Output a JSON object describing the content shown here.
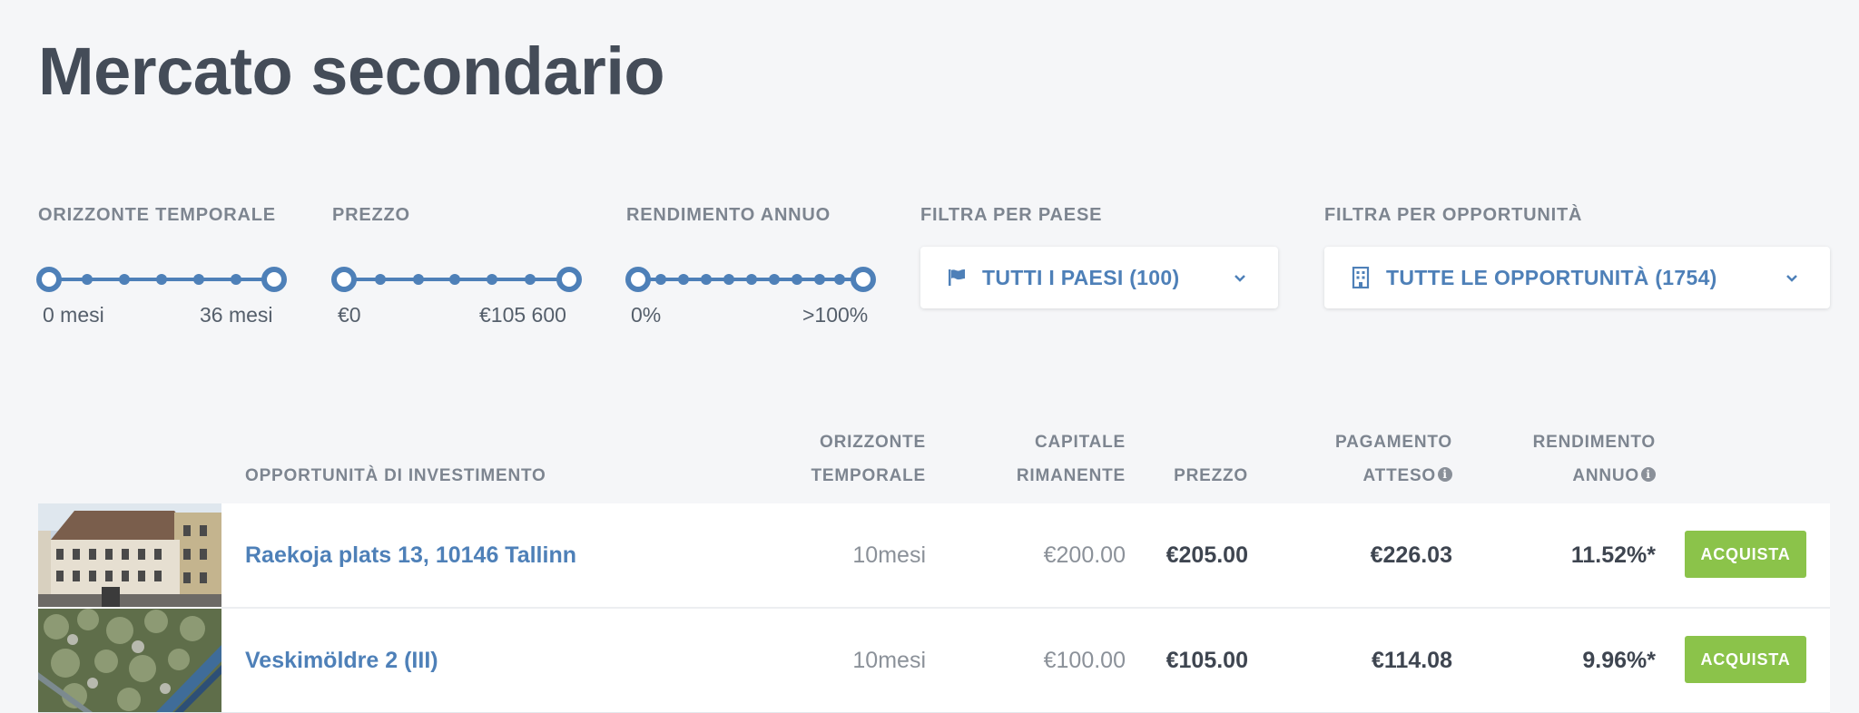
{
  "page": {
    "title": "Mercato secondario"
  },
  "filters": {
    "horizon": {
      "label": "ORIZZONTE TEMPORALE",
      "min": "0 mesi",
      "max": "36 mesi"
    },
    "price": {
      "label": "PREZZO",
      "min": "€0",
      "max": "€105 600"
    },
    "yield": {
      "label": "RENDIMENTO ANNUO",
      "min": "0%",
      "max": ">100%"
    },
    "country": {
      "label": "FILTRA PER PAESE",
      "value": "TUTTI I PAESI (100)",
      "icon": "flag-icon"
    },
    "opportunity": {
      "label": "FILTRA PER OPPORTUNITÀ",
      "value": "TUTTE LE OPPORTUNITÀ (1754)",
      "icon": "building-icon"
    }
  },
  "table": {
    "headers": {
      "opportunity": "OPPORTUNITÀ DI INVESTIMENTO",
      "horizon_1": "ORIZZONTE",
      "horizon_2": "TEMPORALE",
      "capital_1": "CAPITALE",
      "capital_2": "RIMANENTE",
      "price": "PREZZO",
      "payment_1": "PAGAMENTO",
      "payment_2": "ATTESO",
      "yield_1": "RENDIMENTO",
      "yield_2": "ANNUO"
    },
    "rows": [
      {
        "name": "Raekoja plats 13, 10146 Tallinn",
        "horizon": "10mesi",
        "capital": "€200.00",
        "price": "€205.00",
        "payment": "€226.03",
        "yield": "11.52%*",
        "action": "ACQUISTA"
      },
      {
        "name": "Veskimöldre 2 (III)",
        "horizon": "10mesi",
        "capital": "€100.00",
        "price": "€105.00",
        "payment": "€114.08",
        "yield": "9.96%*",
        "action": "ACQUISTA"
      }
    ]
  },
  "colors": {
    "accent": "#4e80b8",
    "buy": "#8bc34a",
    "background": "#f5f6f8"
  }
}
